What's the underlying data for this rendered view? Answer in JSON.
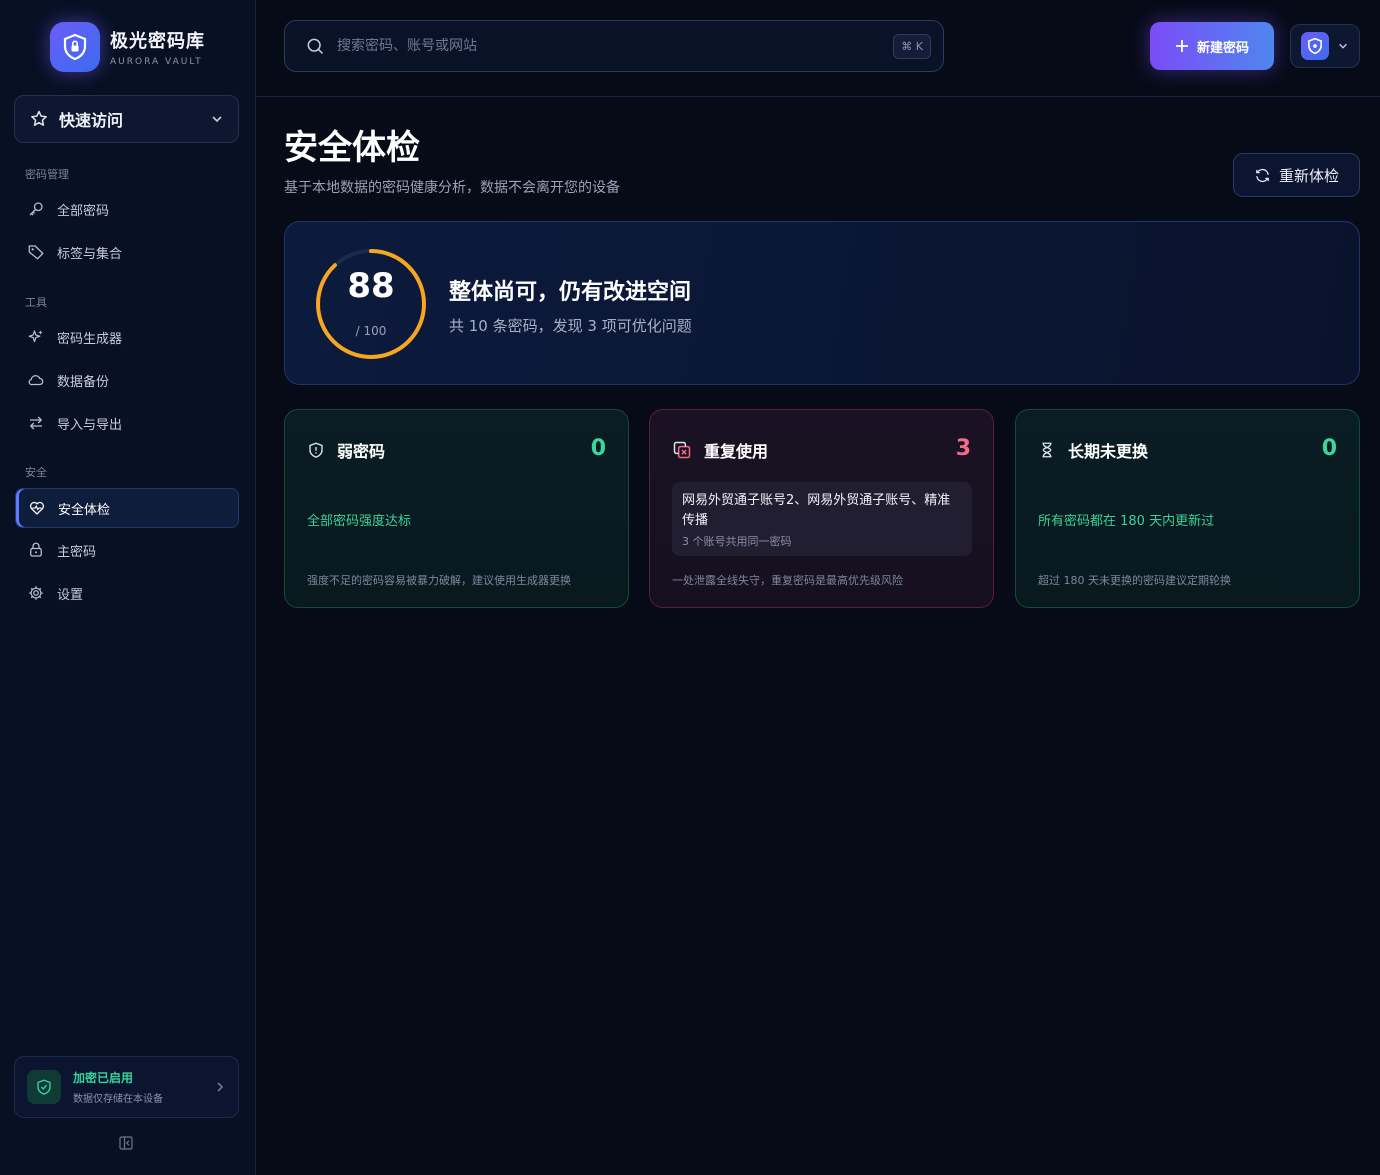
{
  "brand": {
    "name": "极光密码库",
    "sub": "AURORA VAULT"
  },
  "sidebar": {
    "quick_access": "快速访问",
    "sections": [
      {
        "title": "密码管理",
        "items": [
          {
            "label": "全部密码",
            "icon": "key-icon"
          },
          {
            "label": "标签与集合",
            "icon": "tag-icon"
          }
        ]
      },
      {
        "title": "工具",
        "items": [
          {
            "label": "密码生成器",
            "icon": "sparkle-icon"
          },
          {
            "label": "数据备份",
            "icon": "cloud-icon"
          },
          {
            "label": "导入与导出",
            "icon": "swap-icon"
          }
        ]
      },
      {
        "title": "安全",
        "items": [
          {
            "label": "安全体检",
            "icon": "heart-pulse-icon",
            "active": true
          },
          {
            "label": "主密码",
            "icon": "lock-icon"
          },
          {
            "label": "设置",
            "icon": "gear-icon"
          }
        ]
      }
    ],
    "encryption": {
      "title": "加密已启用",
      "sub": "数据仅存储在本设备"
    }
  },
  "search": {
    "placeholder": "搜索密码、账号或网站",
    "shortcut": "⌘ K"
  },
  "header": {
    "new_button": "新建密码"
  },
  "page": {
    "title": "安全体检",
    "subtitle": "基于本地数据的密码健康分析，数据不会离开您的设备",
    "recheck": "重新体检"
  },
  "score": {
    "value": 88,
    "max_label": "/ 100",
    "max": 100,
    "headline": "整体尚可，仍有改进空间",
    "summary": "共 10 条密码，发现 3 项可优化问题",
    "ring_color": "#f5a623"
  },
  "cards": {
    "weak": {
      "title": "弱密码",
      "count": "0",
      "status": "全部密码强度达标",
      "foot": "强度不足的密码容易被暴力破解，建议使用生成器更换"
    },
    "reuse": {
      "title": "重复使用",
      "count": "3",
      "names": "网易外贸通子账号2、网易外贸通子账号、精准传播",
      "detail": "3 个账号共用同一密码",
      "foot": "一处泄露全线失守，重复密码是最高优先级风险"
    },
    "stale": {
      "title": "长期未更换",
      "count": "0",
      "status": "所有密码都在 180 天内更新过",
      "foot": "超过 180 天未更换的密码建议定期轮换"
    }
  }
}
